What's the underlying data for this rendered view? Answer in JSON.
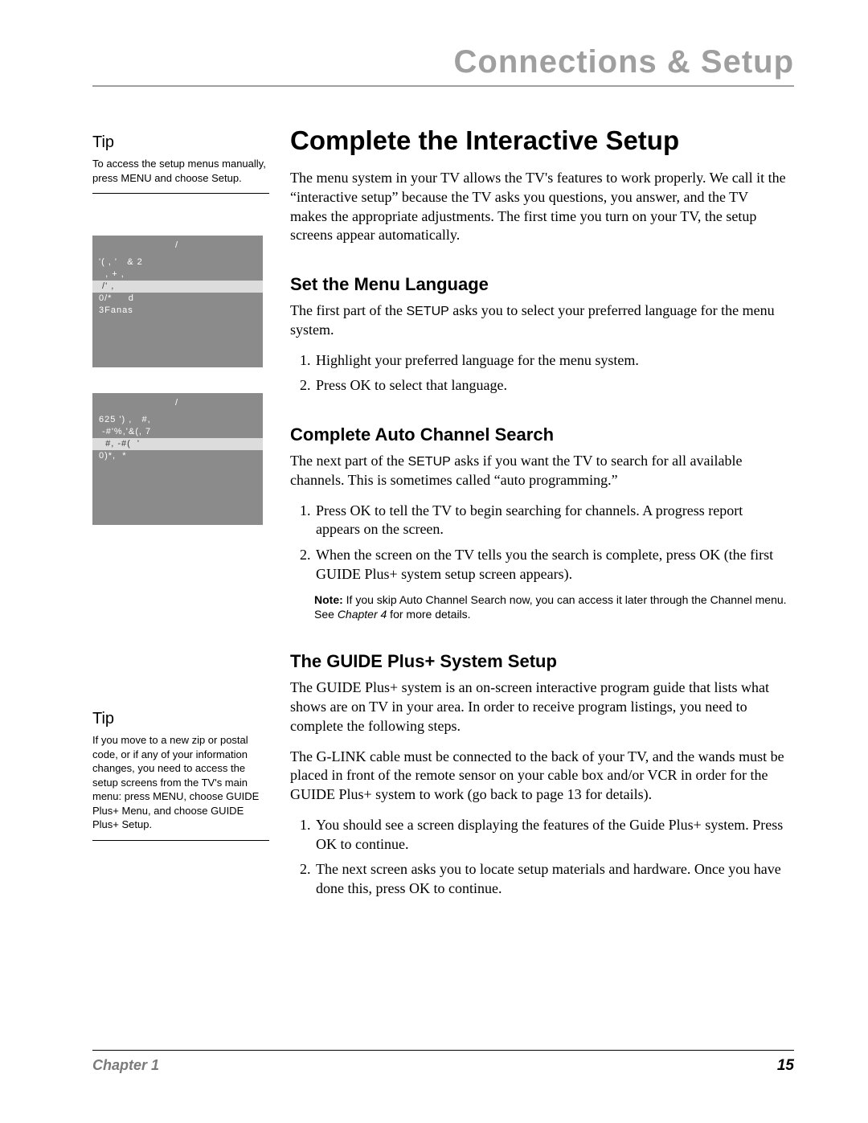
{
  "header": {
    "title": "Connections & Setup"
  },
  "sidebar": {
    "tip1": {
      "heading": "Tip",
      "body": "To access the setup menus manually, press MENU and choose Setup."
    },
    "fig1": {
      "tab": "/",
      "row0": "'( , '   & 2",
      "row1": "  , + ,",
      "row2": " /' ,",
      "row3": "0/*     d",
      "row4": "3Fanas"
    },
    "fig2": {
      "tab": "/",
      "row0": "625 ') ,   #,",
      "row1": " -#'%,'&(, 7",
      "row2": "  #, -#(  '",
      "row3": "0)*,  *"
    },
    "tip2": {
      "heading": "Tip",
      "body": "If you move to a new zip or postal code, or if any of your information changes, you need to access the setup screens from the TV's main menu: press MENU, choose GUIDE Plus+ Menu, and choose GUIDE Plus+ Setup."
    }
  },
  "main": {
    "h1": "Complete the Interactive Setup",
    "p1": "The menu system in your TV allows the TV's features to work properly. We call it the “interactive setup” because the TV asks you questions, you answer, and the TV makes the appropriate adjustments. The first time you turn on your TV, the setup screens appear automatically.",
    "h2a": "Set the Menu Language",
    "p2a_1": "The first part of the ",
    "p2a_kw": "SETUP",
    "p2a_2": " asks you to select your preferred language for the menu system.",
    "ol1_1": "Highlight your preferred language for the menu system.",
    "ol1_2": "Press OK to select that language.",
    "h2b": "Complete Auto Channel Search",
    "p2b_1": "The next part of the ",
    "p2b_kw": "SETUP",
    "p2b_2": " asks if you want the TV to search for all available channels. This is sometimes called “auto programming.”",
    "ol2_1": "Press OK to tell the TV to begin searching for channels. A progress report appears on the screen.",
    "ol2_2": "When the screen on the TV tells you the search is complete, press OK (the first GUIDE Plus+ system setup screen appears).",
    "note_label": "Note:",
    "note_1": " If you skip Auto Channel Search now, you can access it later through the Channel menu. See ",
    "note_i": "Chapter 4",
    "note_2": " for more details.",
    "h2c": "The GUIDE Plus+ System Setup",
    "p3": "The GUIDE Plus+ system is an on-screen interactive program guide that lists what shows are on TV in your area. In order to receive program listings, you need to complete the following steps.",
    "p4": "The G-LINK cable must be connected to the back of your TV, and the wands must be placed in front of the remote sensor on your cable box and/or VCR in order for the GUIDE Plus+ system to work (go back to page 13 for details).",
    "ol3_1": "You should see a screen displaying the features of the Guide Plus+ system. Press OK to continue.",
    "ol3_2": "The next screen asks you to locate setup materials and hardware. Once you have done this, press OK to continue."
  },
  "footer": {
    "chapter": "Chapter 1",
    "pagenum": "15"
  }
}
